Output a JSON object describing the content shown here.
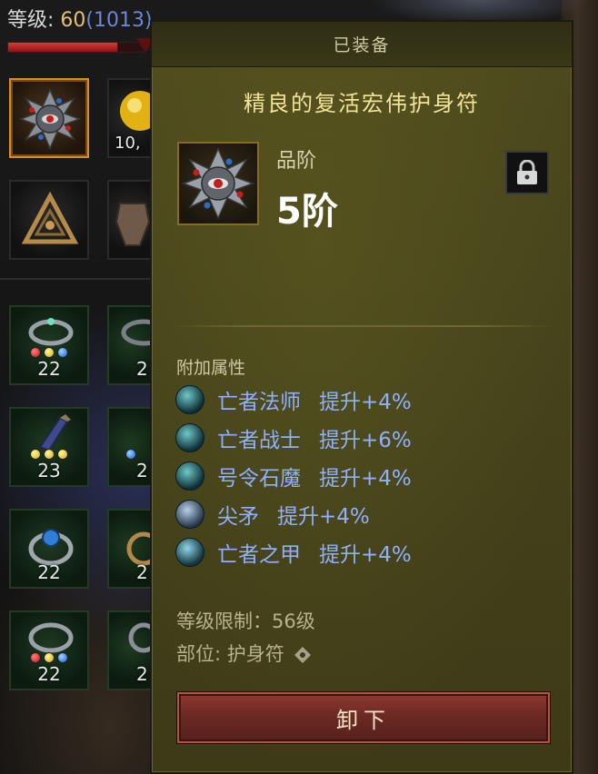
{
  "background": {
    "level_label": "等级:",
    "level_value": "60",
    "level_sub": "(1013)",
    "xp_fill_fraction": 0.8,
    "slots": [
      {
        "count": "",
        "type": "amulet-selected"
      },
      {
        "count": "10,",
        "type": "gold-orb"
      },
      {
        "count": "",
        "type": "triangle-rune"
      },
      {
        "count": "",
        "type": "armor"
      },
      {
        "count": "22",
        "gems": [
          "red",
          "yellow",
          "blue"
        ],
        "type": "ring-green"
      },
      {
        "count": "2",
        "type": "ring-partial"
      },
      {
        "count": "23",
        "gems": [
          "yellow",
          "yellow",
          "yellow"
        ],
        "type": "bracer-green"
      },
      {
        "count": "2",
        "type": "bracer-partial"
      },
      {
        "count": "22",
        "gems": [],
        "type": "ring-blue"
      },
      {
        "count": "2",
        "type": "ring-partial"
      },
      {
        "count": "22",
        "gems": [
          "red",
          "yellow",
          "blue"
        ],
        "type": "ring-green"
      },
      {
        "count": "2",
        "type": "ring-partial"
      }
    ]
  },
  "panel": {
    "header": "已装备",
    "item_name": "精良的复活宏伟护身符",
    "grade_label": "品阶",
    "grade_value": "5阶",
    "section_title": "附加属性",
    "attributes": [
      {
        "name": "亡者法师",
        "bonus": "提升+4%",
        "icon": "necromancer-mage-icon"
      },
      {
        "name": "亡者战士",
        "bonus": "提升+6%",
        "icon": "skeleton-warrior-icon"
      },
      {
        "name": "号令石魔",
        "bonus": "提升+4%",
        "icon": "golem-icon"
      },
      {
        "name": "尖矛",
        "bonus": "提升+4%",
        "icon": "spear-icon"
      },
      {
        "name": "亡者之甲",
        "bonus": "提升+4%",
        "icon": "bone-armor-icon"
      }
    ],
    "level_req": "等级限制：56级",
    "slot_label": "部位: 护身符",
    "unequip_label": "卸下"
  },
  "colors": {
    "item_name": "#f2e39a",
    "attribute_text": "#8fb0ff",
    "unequip_button": "#6d2a24",
    "panel_bg": "#45431b"
  }
}
